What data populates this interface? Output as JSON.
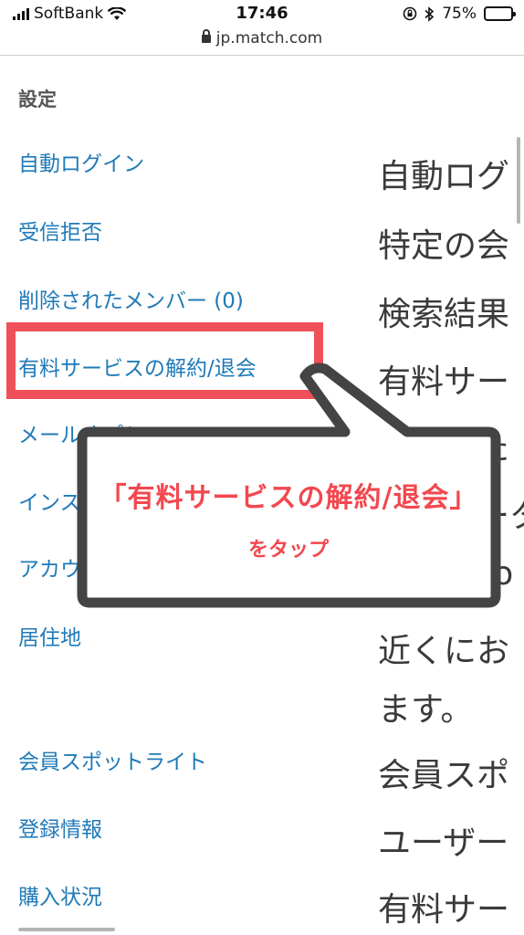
{
  "status_bar": {
    "carrier": "SoftBank",
    "time": "17:46",
    "battery": "75%",
    "battery_level": 0.75
  },
  "browser": {
    "url": "jp.match.com"
  },
  "sidebar": {
    "title": "設定",
    "items": [
      "自動ログイン",
      "受信拒否",
      "削除されたメンバー (0)",
      "有料サービスの解約/退会",
      "メールオプション",
      "インスタントメッセージ",
      "アカウント",
      "居住地",
      "会員スポットライト",
      "登録情報",
      "購入状況"
    ]
  },
  "descriptions": [
    "自動ログ",
    "特定の会",
    "検索結果",
    "有料サー",
    "削除した",
    "メッセータ",
    "Faceboo",
    "近くにお",
    "ます。",
    "会員スポ",
    "ユーザー",
    "有料サー"
  ],
  "callout": {
    "line1": "「有料サービスの解約/退会」",
    "line2": "をタップ"
  },
  "colors": {
    "link": "#1f7ab8",
    "highlight": "#f0505a",
    "callout_text": "#f2484f",
    "callout_border": "#444444"
  }
}
